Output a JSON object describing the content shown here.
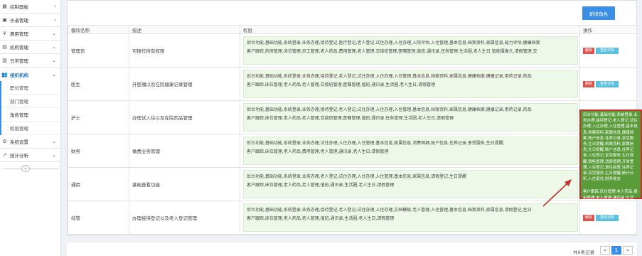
{
  "sidebar": {
    "items": [
      {
        "label": "控制面板",
        "icon": "dashboard-icon",
        "glyph": "▦"
      },
      {
        "label": "长者管理",
        "icon": "user-icon",
        "glyph": "▣"
      },
      {
        "label": "费用管理",
        "icon": "yen-icon",
        "glyph": "¥"
      },
      {
        "label": "机构管理",
        "icon": "building-icon",
        "glyph": "▤"
      },
      {
        "label": "日常管理",
        "icon": "calendar-icon",
        "glyph": "▥"
      }
    ],
    "active": {
      "label": "组织机构",
      "icon": "group-icon",
      "glyph": "👥"
    },
    "subitems": [
      {
        "label": "职位管理"
      },
      {
        "label": "部门管理"
      },
      {
        "label": "角色管理"
      },
      {
        "label": "权限管理"
      }
    ],
    "after": [
      {
        "label": "系统设置",
        "icon": "settings-icon",
        "glyph": "⚙"
      },
      {
        "label": "统计分析",
        "icon": "chart-icon",
        "glyph": "↗"
      }
    ],
    "collapse_glyph": "«"
  },
  "toolbar": {
    "add_label": "新增角色"
  },
  "table": {
    "headers": [
      "模块名称",
      "描述",
      "权限",
      "操作"
    ],
    "rows": [
      {
        "name": "管理员",
        "desc": "可操作所有权限",
        "perm1": "后台功能,基础功能,系统登录,业务办理,接待登记,医疗登记,老人登记,试住办理,入住办理,入院评估,入住管理,基本信息,档案资料,家属信息,能力评估,健康档案",
        "perm2": "客户跟踪,药房管理,床位管理,员工管理,老人药品,费用管理,老人管理,交接班管理,医嘱管理,值班,通讯录,任务管理,生活圈,老人生日,智能摄像头,请假管理,交",
        "has_actions": true
      },
      {
        "name": "医生",
        "desc": "开医嘱以及在院健康记录管理",
        "perm1": "后台功能,基础功能,系统登录,业务办理,接待登记,老人登记,试住办理,入住办理,入住管理,基本信息,档案资料,家属信息,健康档案,健康记录,用药记录,药品",
        "perm2": "客户跟踪,床位管理,老人药品,老人管理,交接班管理,医嘱管理,值班,通讯录,生活圈,老人生日,请假管理",
        "has_actions": true
      },
      {
        "name": "护士",
        "desc": "办理试入住以及在院药品管理",
        "perm1": "后台功能,基础功能,系统登录,业务办理,接待登记,老人登记,试住办理,入住办理,入住管理,基本信息,档案资料,家属信息,健康档案,健康记录,用药记录,药品",
        "perm2": "客户跟踪,床位管理,老人药品,老人管理,交接班管理,医嘱管理,值班,通讯录,任务管理,生活圈,老人生日,请假管理",
        "has_actions": false
      },
      {
        "name": "财务",
        "desc": "做费业务管理",
        "perm1": "后台功能,基础功能,系统登录,业务办理,试住办理,入住办理,入住管理,基本信息,家属信息,消费明细,账户信息,住养记录,享受服务,生日提醒,",
        "perm2": "客户跟踪,床位管理,老人药品,费用管理,老人管理,通讯录,老人生日,请假管理",
        "has_actions": false
      },
      {
        "name": "通用",
        "desc": "基础查看功能",
        "perm1": "后台功能,基础功能,系统登录,业务办理,老人登记,试住办理,入住办理,入住管理,基本信息,家属信息,请假登记,生日提醒",
        "perm2": "客户跟踪,床位管理,老人药品,老人管理,值班,通讯录,生活圈,老人生日,请假管理",
        "has_actions": false
      },
      {
        "name": "综管",
        "desc": "办理接待登记以及老人登记管理",
        "perm1": "后台功能,基础功能,系统登录,业务办理,接待登记,老人登记,试住办理,入住办理,文档模板,老人管理,入住管理,基本信息,档案资料,家属信息,请假登记,生日",
        "perm2": "客户跟踪,床位管理,老人药品,老人管理,值班,通讯录,生活圈,老人生日,请假管理",
        "has_actions": true
      }
    ],
    "delete_label": "删除",
    "view_label": "查看详情"
  },
  "tooltip": {
    "para1": "后台功能,基础功能,系统登录,业务办理,接待登记,老人登记,试住办理,入住办理,入住管理,基本信息,档案资料,家属信息,健康档案,账户信息,住养记录,享受服务,生日提醒,档案资料,家属信息,生日提醒,账户信息,住养记录,入住登记,享受服务,生日提醒,销售管理,消费管理,开发管理,入住登记,退住结算,住养记录,享受服务,生日提醒,统计分析,入住退住,财务收支",
    "para2": "客户跟踪,床位管理,老人药品,费用管理,老人管理,通讯录,生活圈,老人生日,请假管理"
  },
  "pagination": {
    "count_label": "共6条记录",
    "prev": "«",
    "page": "1",
    "next": "»"
  },
  "colors": {
    "primary": "#3a8ee6",
    "danger": "#d9534f",
    "info": "#5bc0de",
    "tooltip_bg": "#5a9b3a",
    "annotation": "#c9302c"
  }
}
